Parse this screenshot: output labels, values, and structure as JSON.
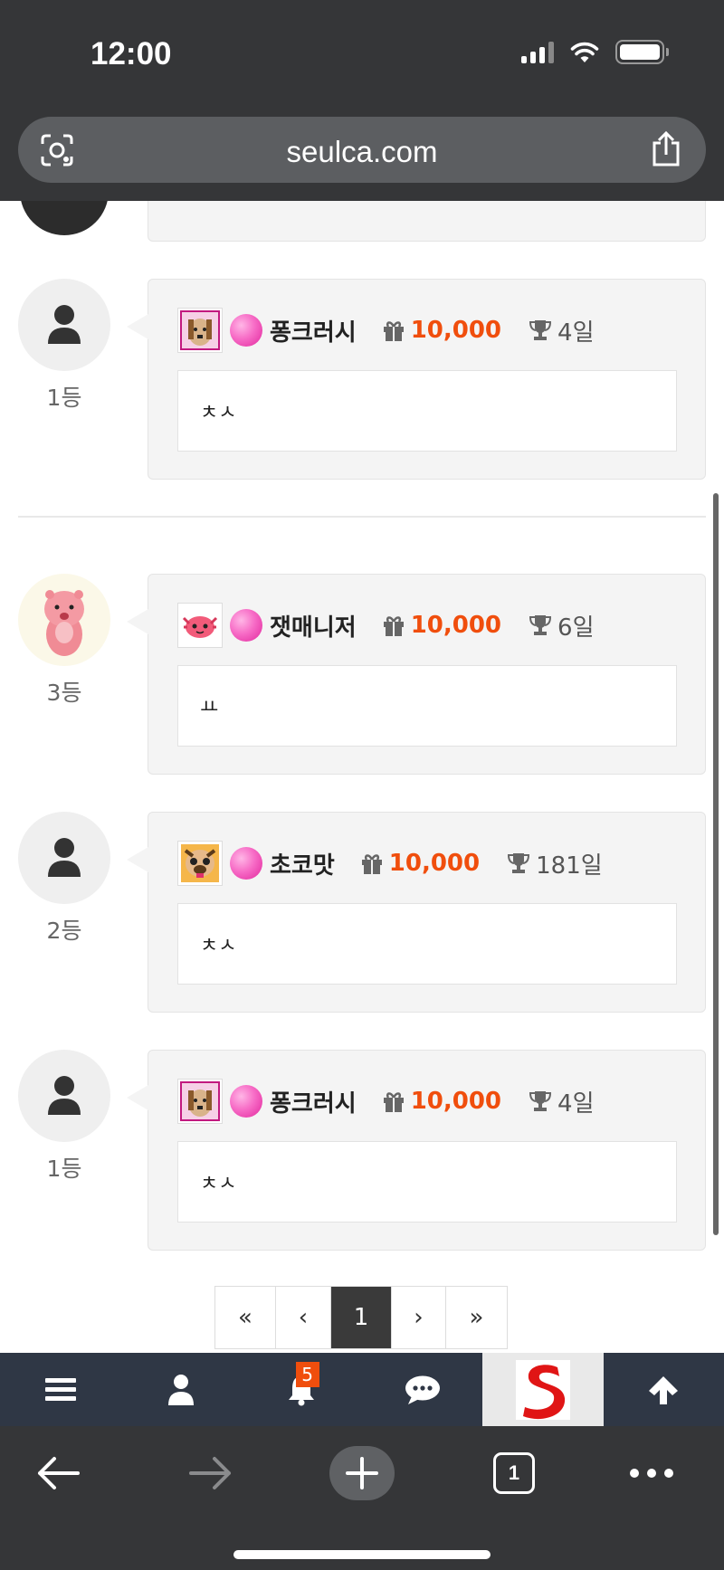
{
  "status_bar": {
    "time": "12:00"
  },
  "address_bar": {
    "url": "seulca.com"
  },
  "comments": [
    {
      "rank": "1등",
      "nickname": "퐁크러시",
      "points": "10,000",
      "days": "4일",
      "text": "ㅊㅅ",
      "avatar": "default-user",
      "level_icon": "dog-face-pink"
    },
    {
      "rank": "3등",
      "nickname": "잿매니저",
      "points": "10,000",
      "days": "6일",
      "text": "ㅛ",
      "avatar": "pink-beaver",
      "level_icon": "pink-axolotl"
    },
    {
      "rank": "2등",
      "nickname": "초코맛",
      "points": "10,000",
      "days": "181일",
      "text": "ㅊㅅ",
      "avatar": "default-user",
      "level_icon": "pug-face"
    },
    {
      "rank": "1등",
      "nickname": "퐁크러시",
      "points": "10,000",
      "days": "4일",
      "text": "ㅊㅅ",
      "avatar": "default-user",
      "level_icon": "dog-face-pink"
    }
  ],
  "pagination": {
    "first": "«",
    "prev": "‹",
    "current": "1",
    "next": "›",
    "last": "»"
  },
  "app_nav": {
    "items": [
      "menu-icon",
      "user-icon",
      "bell-icon",
      "chat-icon",
      "site-logo",
      "arrow-up-icon"
    ],
    "notification_count": "5"
  },
  "browser_toolbar": {
    "tab_count": "1"
  },
  "colors": {
    "accent": "#f04e0d",
    "nav_bg": "#2f3745",
    "browser_chrome": "#353638"
  }
}
